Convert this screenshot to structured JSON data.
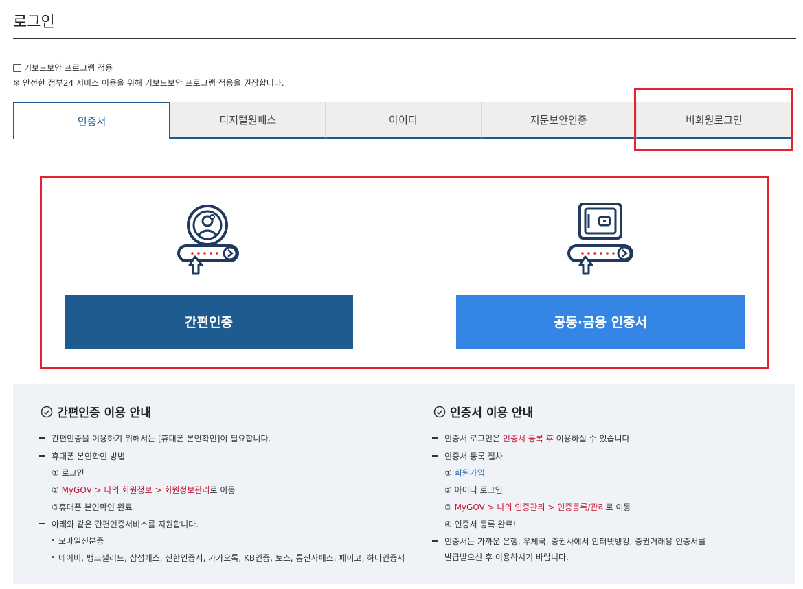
{
  "page": {
    "title": "로그인"
  },
  "keyboard_security": {
    "checkbox_label": "키보드보안 프로그램 적용",
    "note": "※ 안전한 정부24 서비스 이용을 위해 키보드보안 프로그램 적용을 권장합니다."
  },
  "tabs": [
    {
      "label": "인증서",
      "active": true
    },
    {
      "label": "디지털원패스",
      "active": false
    },
    {
      "label": "아이디",
      "active": false
    },
    {
      "label": "지문보안인증",
      "active": false
    },
    {
      "label": "비회원로그인",
      "active": false
    }
  ],
  "login_options": {
    "simple_auth_button": "간편인증",
    "certificate_button": "공동·금융 인증서"
  },
  "simple_auth_info": {
    "heading": "간편인증 이용 안내",
    "line1": "간편인증을 이용하기 위해서는 [휴대폰 본인확인]이 필요합니다.",
    "line2": "휴대폰 본인확인 방법",
    "step1": "① 로그인",
    "step2_prefix": "② ",
    "step2_link": "MyGOV > 나의 회원정보 > 회원정보관리",
    "step2_suffix": "로 이동",
    "step3": "③휴대폰 본인확인 완료",
    "line3": "아래와 같은 간편인증서비스를 지원합니다.",
    "bullet1": "모바일신분증",
    "bullet2": "네이버, 뱅크샐러드, 삼성패스, 신한인증서, 카카오톡, KB인증, 토스, 통신사패스, 페이코, 하나인증서"
  },
  "cert_info": {
    "heading": "인증서 이용 안내",
    "line1_prefix": "인증서 로그인은 ",
    "line1_highlight": "인증서 등록 후",
    "line1_suffix": " 이용하실 수 있습니다.",
    "line2": "인증서 등록 절차",
    "step1_prefix": "① ",
    "step1_link": "회원가입",
    "step2": "② 아이디 로그인",
    "step3_prefix": "③ ",
    "step3_link": "MyGOV > 나의 인증관리 > 인증등록/관리",
    "step3_suffix": "로 이동",
    "step4": "④ 인증서 등록 완료!",
    "line3a": "인증서는 가까운 은행, 우체국, 증권사에서 인터넷뱅킹, 증권거래용 인증서를",
    "line3b": "발급받으신 후 이용하시기 바랍니다."
  },
  "colors": {
    "primary_dark": "#1d5b91",
    "primary_light": "#3585e4",
    "highlight_red": "#c8102e",
    "annotation_red": "#e3232e"
  }
}
